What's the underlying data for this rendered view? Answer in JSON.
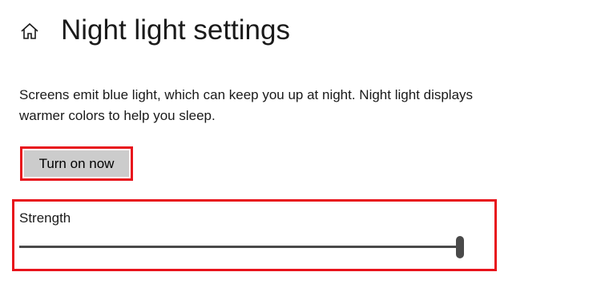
{
  "header": {
    "home_icon": "home-icon",
    "title": "Night light settings"
  },
  "description": "Screens emit blue light, which can keep you up at night. Night light displays warmer colors to help you sleep.",
  "turn_on_button": {
    "label": "Turn on now"
  },
  "strength": {
    "label": "Strength",
    "value_fraction": 1.0
  },
  "colors": {
    "highlight": "#e8141c",
    "button_bg": "#cccccc",
    "slider": "#4a4a4a"
  }
}
